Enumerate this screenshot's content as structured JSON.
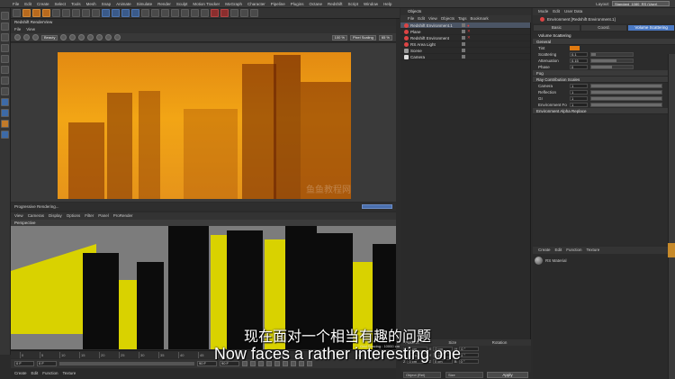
{
  "menubar": {
    "items": [
      "File",
      "Edit",
      "Create",
      "Select",
      "Tools",
      "Mesh",
      "Snap",
      "Animate",
      "Simulate",
      "Render",
      "Sculpt",
      "Motion Tracker",
      "MoGraph",
      "Character",
      "Pipeline",
      "Plugins",
      "Octane",
      "Redshift",
      "Script",
      "Window",
      "Help"
    ],
    "layout_label": "Layout:",
    "layout_value": "Standard_1080_RS (User)"
  },
  "renderview": {
    "title": "Redshift RenderView",
    "menu": [
      "File",
      "View"
    ],
    "beauty_dd": "Beauty",
    "zoom": "100 %",
    "pixel_scaling": "Pixel Scaling",
    "percent": "65 %",
    "status": "Progressive Rendering..."
  },
  "viewport": {
    "menu": [
      "View",
      "Cameras",
      "Display",
      "Options",
      "Filter",
      "Panel",
      "ProRender"
    ],
    "label": "Perspective",
    "grid_spacing": "Grid Spacing : 10000 cm"
  },
  "timeline": {
    "ticks": [
      "0",
      "5",
      "10",
      "15",
      "20",
      "25",
      "30",
      "35",
      "40",
      "45",
      "50",
      "55",
      "60",
      "65",
      "70",
      "75",
      "80",
      "85",
      "90"
    ],
    "start_field": "0 F",
    "current_field": "0 F",
    "end_field": "90 F",
    "end2_field": "90 F"
  },
  "materials_bar": {
    "items": [
      "Create",
      "Edit",
      "Function",
      "Texture"
    ]
  },
  "objects": {
    "title": "Objects",
    "menu": [
      "File",
      "Edit",
      "View",
      "Objects",
      "Tags",
      "Bookmark"
    ],
    "rows": [
      {
        "name": "Redshift Environment.1",
        "icon": "red",
        "selected": true
      },
      {
        "name": "Plane",
        "icon": "red",
        "selected": false
      },
      {
        "name": "Redshift Environment",
        "icon": "red",
        "selected": false
      },
      {
        "name": "RS Area Light",
        "icon": "red",
        "selected": false
      },
      {
        "name": "Scene",
        "icon": "gray",
        "selected": false
      },
      {
        "name": "Camera",
        "icon": "white",
        "selected": false
      }
    ]
  },
  "coordinates": {
    "headers": [
      "Position",
      "Size",
      "Rotation"
    ],
    "rows": [
      {
        "axis": "X",
        "pos": "0 cm",
        "size": "0 cm",
        "rot_label": "H",
        "rot": "0 °"
      },
      {
        "axis": "Y",
        "pos": "0 cm",
        "size": "0 cm",
        "rot_label": "P",
        "rot": "0 °"
      },
      {
        "axis": "Z",
        "pos": "0 cm",
        "size": "0 cm",
        "rot_label": "B",
        "rot": "0 °"
      }
    ],
    "world": "Object (Rel)",
    "size_mode": "Size",
    "apply": "Apply"
  },
  "attributes": {
    "menu": [
      "Mode",
      "Edit",
      "User Data"
    ],
    "object": "Environment [Redshift Environment.1]",
    "tabs": [
      "Basic",
      "Coord.",
      "Volume Scattering"
    ],
    "active_tab": "Volume Scattering",
    "section_title": "Volume Scattering",
    "general": "General",
    "tint_label": "Tint",
    "tint_color": "#e07a10",
    "fields": [
      {
        "label": "Scattering",
        "value": "0.1",
        "fill": 0.1
      },
      {
        "label": "Attenuation",
        "value": "0.15",
        "fill": 0.6
      },
      {
        "label": "Phase",
        "value": "0",
        "fill": 0.5
      }
    ],
    "fog": "Fog",
    "ray_title": "Ray Contribution Scales",
    "ray_fields": [
      {
        "label": "Camera",
        "value": "1"
      },
      {
        "label": "Reflection",
        "value": "1"
      },
      {
        "label": "GI",
        "value": "1"
      },
      {
        "label": "Environment Fog",
        "value": "1"
      }
    ],
    "alpha": "Environment Alpha Replace"
  },
  "material_manager": {
    "menu": [
      "Create",
      "Edit",
      "Function",
      "Texture"
    ],
    "material_name": "RS Material"
  },
  "subtitles": {
    "cn": "现在面对一个相当有趣的问题",
    "en": "Now faces a rather interesting one"
  },
  "watermark": "鱼鱼教程网"
}
